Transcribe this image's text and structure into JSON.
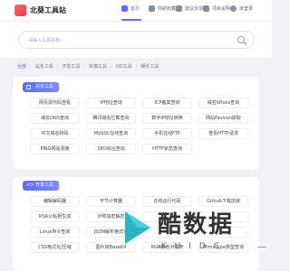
{
  "app": {
    "name": "北葵工具站"
  },
  "nav": [
    {
      "label": "首页",
      "icon": "home-icon"
    },
    {
      "label": "导航收藏",
      "icon": "bookmark-icon"
    },
    {
      "label": "建议反馈",
      "icon": "feedback-icon"
    },
    {
      "label": "项目说明",
      "icon": "doc-icon"
    },
    {
      "label": "未登录",
      "icon": "user-icon"
    }
  ],
  "search": {
    "placeholder": "请输入工具名称..."
  },
  "tabs": [
    "全部",
    "站长工具",
    "开发工具",
    "实用工具",
    "OO工具",
    "娱乐工具"
  ],
  "sections": [
    {
      "title": "站长工具",
      "items": [
        "网页源代码查看",
        "IP地址查询",
        "ICP备案查询",
        "域名Whois查询",
        "域名DNS查询",
        "腾讯域名拦截查询",
        "数字IP地址转换",
        "网站Favicon获取",
        "中文域名转码",
        "MySQL在线查询",
        "手机在线FTP",
        "查看HTTP请求",
        "PING网站测速",
        "SEO综合查询",
        "HTTP状态查询"
      ]
    },
    {
      "title": "开发工具",
      "items": [
        "编辑解码器",
        "字节计算器",
        "在线运行代码",
        "Github下载加速",
        "RSA公私钥生成",
        "对称加密解密",
        "",
        "",
        "Linux命令查询",
        "JSON解析格式化",
        "",
        "",
        "CSS格式化/压缩",
        "图片转Base64",
        "RGB颜色对照表",
        "MimeType类型查询"
      ]
    }
  ],
  "watermark": {
    "text": "酷数据",
    "sub": "KUIDC"
  },
  "colors": {
    "accent": "#5b6cff",
    "logo": "#e63946",
    "watermark_teal": "#2bb3c0"
  }
}
